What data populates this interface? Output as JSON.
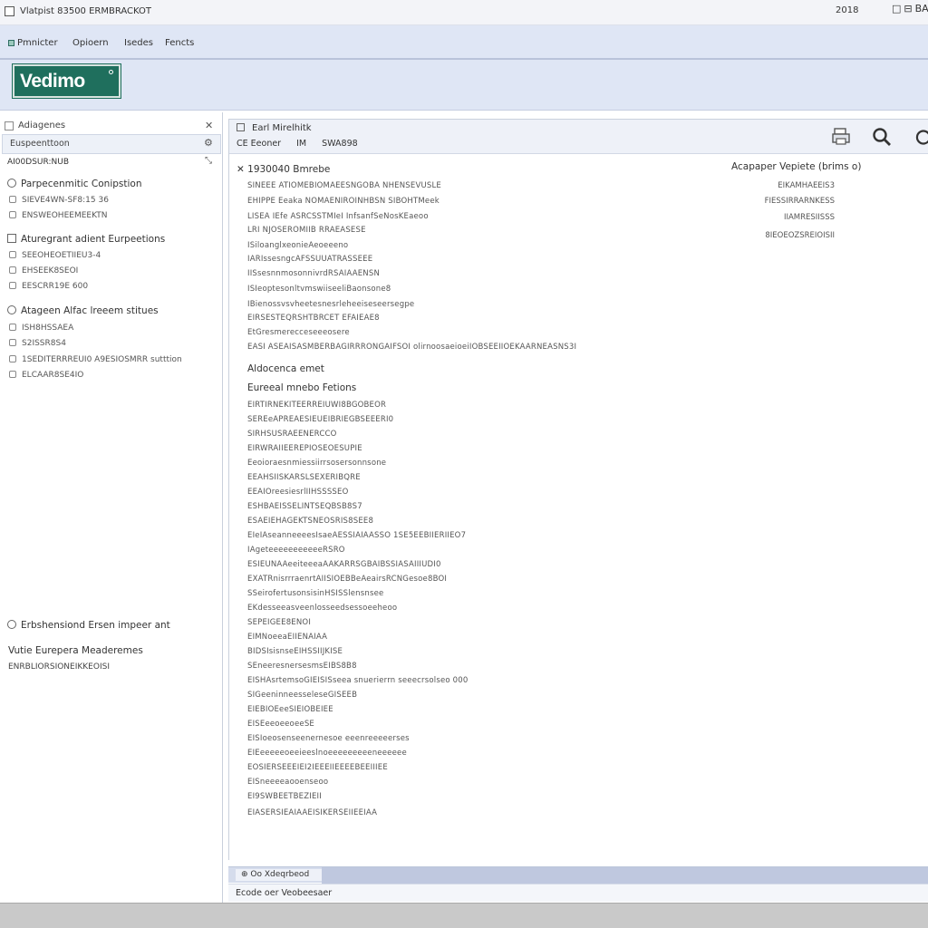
{
  "window": {
    "title": "Vlatpist 83500 ERMBRACKOT",
    "year_text": "2018",
    "controls": [
      "□",
      "⊟",
      "BAC"
    ]
  },
  "menubar": {
    "items": [
      "Pmnicter",
      "Opioern",
      "Isedes",
      "Fencts"
    ]
  },
  "logo": {
    "text": "Vedimo"
  },
  "sidebar": {
    "header_label": "Adiagenes",
    "search_value": "Euspeenttoon",
    "sub_label": "AI00DSUR:NUB",
    "groups": [
      {
        "label": "Parpecenmitic Conipstion",
        "items": [
          "SIEVE4WN-SF8:15 36",
          "ENSWEOHEEMEEKTN"
        ]
      },
      {
        "label": "Aturegrant adient Eurpeetions",
        "items": [
          "SEEOHEOETIIEU3-4",
          "EHSEEK8SEOI",
          "EESCRR19E 600"
        ]
      },
      {
        "label": "Atageen Alfac lreeem stitues",
        "items": [
          "ISH8HSSAEA",
          "S2ISSR8S4",
          "1SEDITERRREUI0 A9ESIOSMRR sutttion",
          "ELCAAR8SE4IO"
        ]
      }
    ],
    "bottom_title": "Erbshensiond Ersen impeer ant",
    "bottom_title2": "Vutie Eurepera Meaderemes",
    "bottom_sub": "ENRBLIORSIONEIKKEOISI"
  },
  "main": {
    "toolbar_title": "Earl Mirelhitk",
    "toolbar_items": [
      "CE Eeoner",
      "IM",
      "SWA898"
    ],
    "section_title": "1930040 Bmrebe",
    "lines_a": [
      "SINEEE ATIOMEBIOMAEESNGOBA NHENSEVUSLE",
      "EHIPPE Eeaka NOMAENIROINHBSN SIBOHTMeek",
      "LISEA IEfe ASRCSSTMIeI InfsanfSeNosKEaeoo",
      "LRI NJOSEROMIIB RRAEASESE",
      "ISiloanglxeonieAeoeeeno",
      "IARIssesngcAFSSUUATRASSEEE",
      "IISsesnnmosonnivrdRSAIAAENSN",
      "ISIeoptesonltvmswiiseeliBaonsone8",
      "IBienossvsvheetesnesrleheeiseseersegpe",
      "EIRSESTEQRSHTBRCET EFAIEAE8",
      "EtGresmerecceseeeosere",
      "EASI ASEAISASMBERBAGIRRRONGAIFSOI olirnoosaeioeiIOBSEEIIOEKAARNEASNS3I"
    ],
    "sub1": "Aldocenca emet",
    "sub2": "Eureeal mnebo Fetions",
    "lines_b": [
      "EIRTIRNEKITEERREIUWI8BGOBEOR",
      "SEREeAPREAESIEUEIBRIEGBSEEERI0",
      "SIRHSUSRAEENERCCO",
      "EIRWRAIIEEREPIOSEOESUPIE",
      "Eeoioraesnmiessiirrsosersonnsone",
      "EEAHSIISKARSLSEXERIBQRE",
      "EEAIOreesiesrlIIHSSSSEO",
      "ESHBAEISSELINTSEQBSB8S7",
      "ESAEIEHAGEKTSNEOSRIS8SEE8",
      "EIeIAseanneeeesIsaeAESSIAIAASSO 1SE5EEBIIERIIEO7",
      "IAgeteeeeeeeeeeeRSRO",
      "ESIEUNAAeeiteeeaAAKARRSGBAIBSSIASAIIIUDI0",
      "EXATRnisrrraenrtAIISIOEBBeAeairsRCNGesoe8BOI",
      "SSeirofertusonsisinHSISSlensnsee",
      "EKdesseeasveenlosseedsessoeeheoo",
      "SEPEIGEE8ENOI",
      "EIMNoeeaEIIENAIAA",
      "BIDSIsisnseEIHSSIIJKISE",
      "SEneeresnersesmsEIBS8B8",
      "EISHAsrtemsoGIEISISseea snuerierrn seeecrsolseo 000",
      "SIGeeninneesseleseGISEEB",
      "EIEBIOEeeSIEIOBEIEE",
      "EISEeeoeeoeeSE",
      "EISIoeosenseenernesoe eeenreeeeerses",
      "EIEeeeeeoeeieeslnoeeeeeeeeeneeeeee",
      "EOSIERSEEEIEI2IEEEIIEEEEBEEIIIEE",
      "EISneeeeaooenseoo",
      "EI9SWBEETBEZIEII",
      "EIASERSIEAIAAEISIKERSEIIEEIAA"
    ],
    "right_header": "Acapaper Vepiete (brims o)",
    "right_values": [
      "EIKAMHAEEIS3",
      "FIESSIRRARNKESS",
      "IIAMRESIISSS",
      "8IEOEOZSREIOISII"
    ]
  },
  "statusbar": {
    "tab_text": "⊕ Oo Xdeqrbeod",
    "bottom_text": "Ecode oer Veobeesaer"
  }
}
